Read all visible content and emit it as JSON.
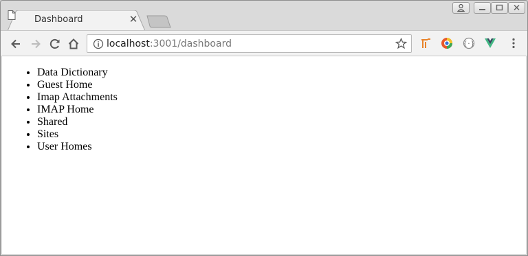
{
  "tab": {
    "title": "Dashboard"
  },
  "omnibox": {
    "host": "localhost",
    "rest": ":3001/dashboard"
  },
  "nav_items": [
    "Data Dictionary",
    "Guest Home",
    "Imap Attachments",
    "IMAP Home",
    "Shared",
    "Sites",
    "User Homes"
  ],
  "colors": {
    "accent_orange": "#e8832a",
    "vue_green": "#41b883",
    "vue_dark": "#35495e"
  }
}
